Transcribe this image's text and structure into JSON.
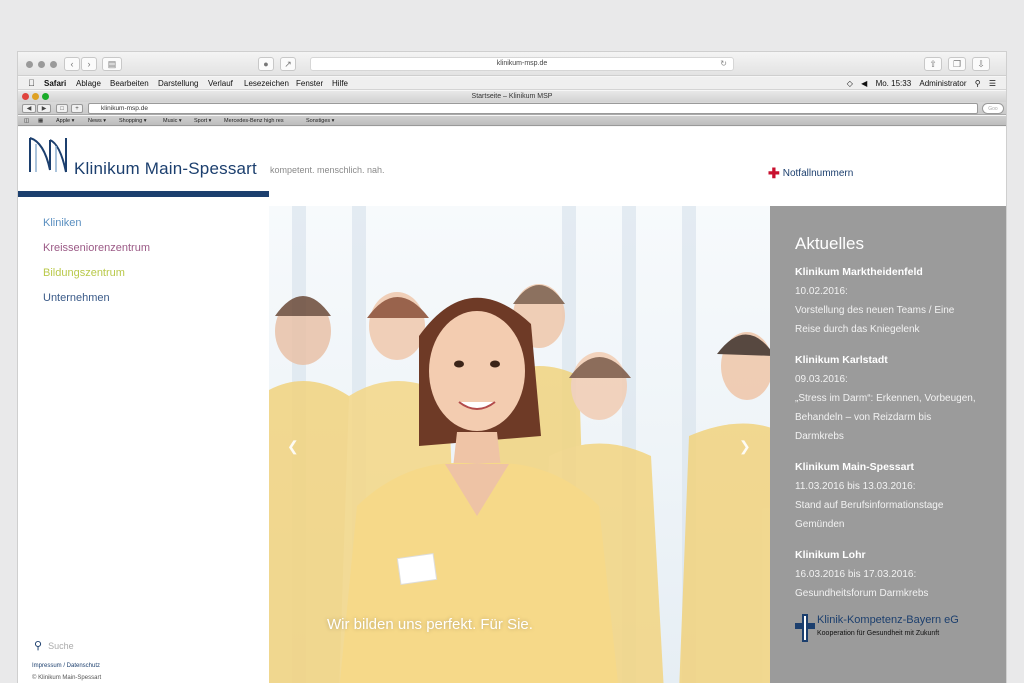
{
  "outer_browser": {
    "url": "klinikum-msp.de"
  },
  "menubar": {
    "app": "Safari",
    "items": [
      "Ablage",
      "Bearbeiten",
      "Darstellung",
      "Verlauf",
      "Lesezeichen",
      "Fenster",
      "Hilfe"
    ],
    "clock": "Mo. 15:33",
    "user": "Administrator"
  },
  "inner_browser": {
    "title": "Startseite – Klinikum MSP",
    "url": "klinikum-msp.de",
    "bookmarks": [
      "Apple ▾",
      "News ▾",
      "Shopping ▾",
      "Music ▾",
      "Sport ▾",
      "Mercedes-Benz high res",
      "Sonstiges ▾"
    ]
  },
  "site": {
    "brand": "Klinikum Main-Spessart",
    "tagline": "kompetent. menschlich. nah.",
    "notfall": "Notfallnummern",
    "nav": [
      {
        "label": "Kliniken",
        "color": "#5a8fc0"
      },
      {
        "label": "Kreisseniorenzentrum",
        "color": "#9b5a86"
      },
      {
        "label": "Bildungszentrum",
        "color": "#b9c94a"
      },
      {
        "label": "Unternehmen",
        "color": "#3a5a88"
      }
    ],
    "search_placeholder": "Suche",
    "footer_links": "Impressum / Datenschutz",
    "copyright": "© Klinikum Main-Spessart",
    "hero_caption": "Wir bilden uns perfekt. Für Sie.",
    "news_heading": "Aktuelles",
    "news": [
      {
        "title": "Klinikum Marktheidenfeld",
        "lines": [
          "10.02.2016:",
          "Vorstellung des neuen Teams / Eine",
          "Reise durch das Kniegelenk"
        ]
      },
      {
        "title": "Klinikum Karlstadt",
        "lines": [
          "09.03.2016:",
          "„Stress im Darm“: Erkennen, Vorbeugen,",
          "Behandeln – von Reizdarm bis",
          "Darmkrebs"
        ]
      },
      {
        "title": "Klinikum Main-Spessart",
        "lines": [
          "11.03.2016 bis 13.03.2016:",
          "Stand auf Berufsinformationstage",
          "Gemünden"
        ]
      },
      {
        "title": "Klinikum Lohr",
        "lines": [
          "16.03.2016 bis 17.03.2016:",
          "Gesundheitsforum Darmkrebs"
        ]
      }
    ],
    "partner_name": "Klinik-Kompetenz-Bayern eG",
    "partner_sub": "Kooperation für Gesundheit mit Zukunft"
  },
  "colors": {
    "brand_blue": "#1c3f6e",
    "news_gray": "#9b9b9b",
    "scrub_yellow": "#f2d37e",
    "emergency_red": "#c8102e"
  }
}
